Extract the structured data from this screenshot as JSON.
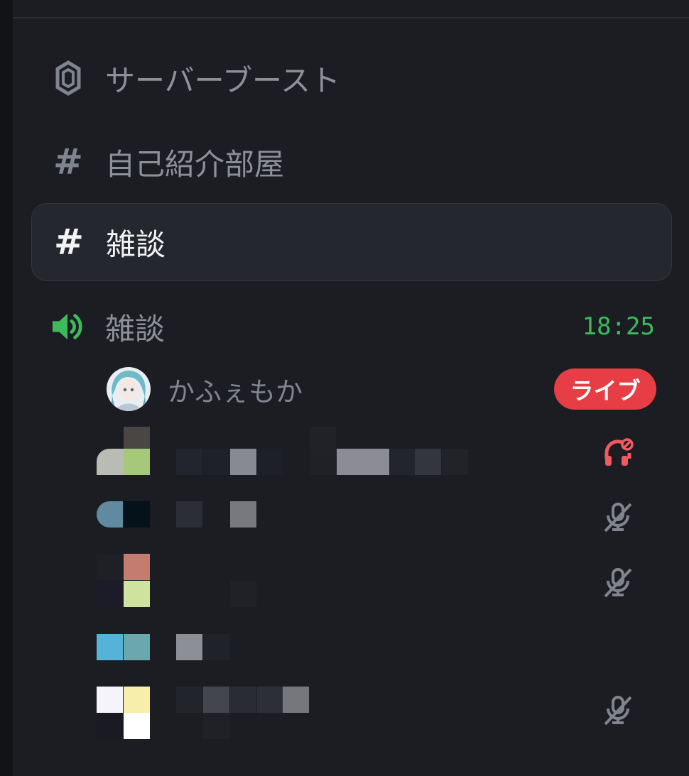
{
  "channels": [
    {
      "type": "boost",
      "icon": "server-boost-icon",
      "label": "サーバーブースト"
    },
    {
      "type": "text",
      "icon": "hash-icon",
      "label": "自己紹介部屋"
    },
    {
      "type": "text",
      "icon": "hash-icon",
      "label": "雑談",
      "selected": true
    }
  ],
  "voice_channel": {
    "icon": "speaker-icon",
    "label": "雑談",
    "elapsed": "18:25",
    "accent": "#3dba5c"
  },
  "members": [
    {
      "name": "かふぇもか",
      "badge": "ライブ",
      "badge_color": "#e63e44"
    },
    {
      "name": "",
      "status_icon": "deafened-headphones-icon"
    },
    {
      "name": "",
      "status_icon": "muted-mic-icon"
    },
    {
      "name": "",
      "status_icon": "muted-mic-icon"
    },
    {
      "name": ""
    },
    {
      "name": "",
      "status_icon": "muted-mic-icon"
    }
  ]
}
